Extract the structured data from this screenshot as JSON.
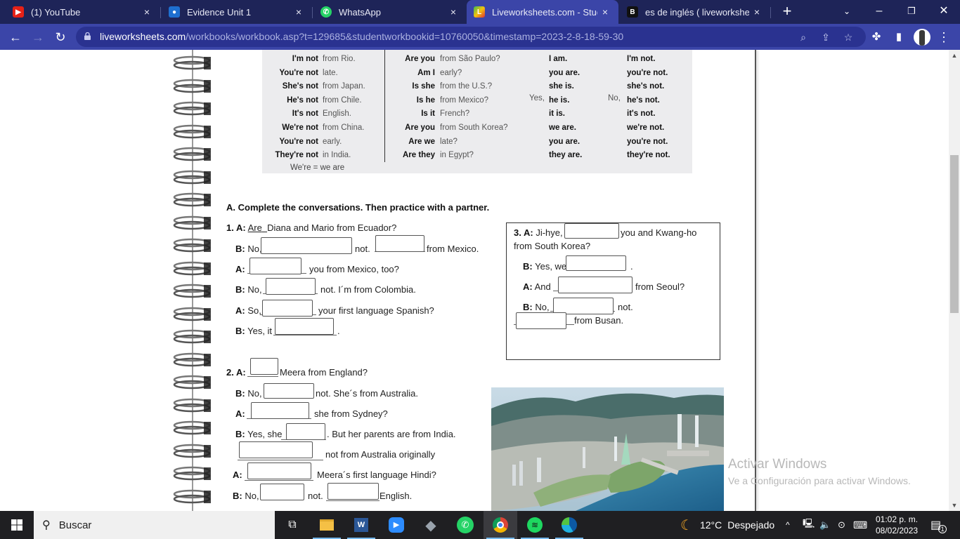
{
  "browser": {
    "tabs": [
      {
        "title": "(1) YouTube",
        "icon": "youtube-icon",
        "active": false
      },
      {
        "title": "Evidence Unit 1",
        "icon": "classroom-icon",
        "active": false
      },
      {
        "title": "WhatsApp",
        "icon": "whatsapp-icon",
        "active": false
      },
      {
        "title": "Liveworksheets.com - Studen",
        "icon": "liveworksheets-icon",
        "active": true
      },
      {
        "title": "es de inglés ( liveworksheets",
        "icon": "b-icon",
        "active": false
      }
    ],
    "close_glyph": "×",
    "new_tab_glyph": "+",
    "url_domain": "liveworksheets.com",
    "url_path": "/workbooks/workbook.asp?t=129685&studentworkbookid=10760050&timestamp=2023-2-8-18-59-30"
  },
  "grammar_table": {
    "negatives": [
      {
        "subject": "I'm not",
        "rest": "from Rio."
      },
      {
        "subject": "You're not",
        "rest": "late."
      },
      {
        "subject": "She's not",
        "rest": "from Japan."
      },
      {
        "subject": "He's not",
        "rest": "from Chile."
      },
      {
        "subject": "It's not",
        "rest": "English."
      },
      {
        "subject": "We're not",
        "rest": "from China."
      },
      {
        "subject": "You're not",
        "rest": "early."
      },
      {
        "subject": "They're not",
        "rest": "in India."
      }
    ],
    "questions": [
      {
        "q": "Are you",
        "rest": "from São Paulo?"
      },
      {
        "q": "Am I",
        "rest": "early?"
      },
      {
        "q": "Is she",
        "rest": "from the U.S.?"
      },
      {
        "q": "Is he",
        "rest": "from Mexico?"
      },
      {
        "q": "Is it",
        "rest": "French?"
      },
      {
        "q": "Are you",
        "rest": "from South Korea?"
      },
      {
        "q": "Are we",
        "rest": "late?"
      },
      {
        "q": "Are they",
        "rest": "in Egypt?"
      }
    ],
    "yes_label": "Yes,",
    "no_label": "No,",
    "yes_answers": [
      "I am.",
      "you are.",
      "she is.",
      "he is.",
      "it is.",
      "we are.",
      "you are.",
      "they are."
    ],
    "no_answers": [
      "I'm not.",
      "you're not.",
      "she's not.",
      "he's not.",
      "it's not.",
      "we're not.",
      "you're not.",
      "they're not."
    ],
    "note": "We're = we are"
  },
  "exercise": {
    "title": "A. Complete the conversations. Then practice with a partner.",
    "c1": {
      "l1_label": "1. A:",
      "l1_answer": "Are",
      "l1_rest": "Diana and Mario from Ecuador?",
      "l2_label": "B:",
      "l2_a": "No,",
      "l2_b": "not.",
      "l2_c": "from Mexico.",
      "l3_label": "A:",
      "l3_a": "you from Mexico, too?",
      "l4_label": "B:",
      "l4_a": "No,",
      "l4_b": "not.  I´m from Colombia.",
      "l5_label": "A:",
      "l5_a": "So,",
      "l5_b": "your first language Spanish?",
      "l6_label": "B:",
      "l6_a": "Yes, it",
      "l6_b": "."
    },
    "c2": {
      "l1_label": "2. A:",
      "l1_a": "Meera from England?",
      "l2_label": "B:",
      "l2_a": "No,",
      "l2_b": "not. She´s from Australia.",
      "l3_label": "A:",
      "l3_a": "she from Sydney?",
      "l4_label": "B:",
      "l4_a": "Yes, she",
      "l4_b": ". But her parents are from India.",
      "l5_a": "not from Australia originally",
      "l6_label": "A:",
      "l6_a": "Meera´s first language Hindi?",
      "l7_label": "B:",
      "l7_a": "No,",
      "l7_b": "not.",
      "l7_c": "English."
    },
    "c3": {
      "l1_label": "3. A:",
      "l1_a": "Ji-hye,",
      "l1_b": "you and Kwang-ho",
      "l1_c": "from South Korea?",
      "l2_label": "B:",
      "l2_a": "Yes, we",
      "l2_b": ".",
      "l3_label": "A:",
      "l3_a": "And",
      "l3_b": "from Seoul?",
      "l4_label": "B:",
      "l4_a": "No,",
      "l4_b": "not.",
      "l5_a": "from Busan."
    },
    "blank_value": ""
  },
  "watermark": {
    "title": "Activar Windows",
    "subtitle": "Ve a Configuración para activar Windows."
  },
  "taskbar": {
    "search_placeholder": "Buscar",
    "apps": [
      "task-view",
      "file-explorer",
      "word",
      "zoom",
      "app-diamond",
      "whatsapp",
      "chrome",
      "spotify",
      "edge"
    ],
    "weather_temp": "12°C",
    "weather_desc": "Despejado",
    "time": "01:02 p. m.",
    "date": "08/02/2023",
    "notification_count": "1"
  }
}
